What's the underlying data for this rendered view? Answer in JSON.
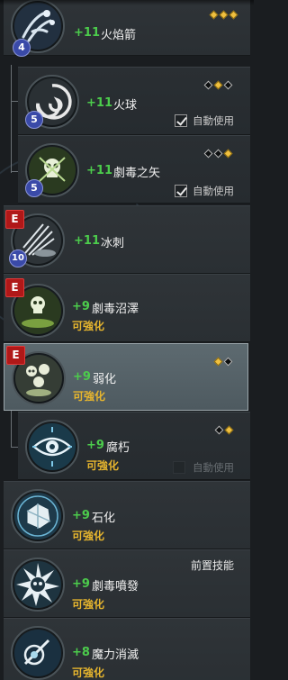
{
  "skills": [
    {
      "id": "fire-arrow",
      "bonus": "+11",
      "name": "火焰箭",
      "level": "4",
      "e_badge": false,
      "upgradable": null,
      "gems": [
        "gold",
        "gold",
        "gold"
      ],
      "auto_use": null,
      "prereq": null,
      "sub": false
    },
    {
      "id": "fireball",
      "bonus": "+11",
      "name": "火球",
      "level": "5",
      "e_badge": false,
      "upgradable": null,
      "gems": [
        "empty",
        "gold",
        "empty"
      ],
      "auto_use": {
        "label": "自動使用",
        "checked": true,
        "enabled": true
      },
      "prereq": null,
      "sub": true
    },
    {
      "id": "poison-arrow",
      "bonus": "+11",
      "name": "劇毒之矢",
      "level": "5",
      "e_badge": false,
      "upgradable": null,
      "gems": [
        "empty",
        "empty",
        "gold"
      ],
      "auto_use": {
        "label": "自動使用",
        "checked": true,
        "enabled": true
      },
      "prereq": null,
      "sub": true
    },
    {
      "id": "ice-spike",
      "bonus": "+11",
      "name": "冰刺",
      "level": "10",
      "e_badge": true,
      "e_label": "E",
      "upgradable": null,
      "gems": [],
      "auto_use": null,
      "prereq": null,
      "sub": false
    },
    {
      "id": "poison-swamp",
      "bonus": "+9",
      "name": "劇毒沼澤",
      "level": null,
      "e_badge": true,
      "e_label": "E",
      "upgradable": "可強化",
      "gems": [],
      "auto_use": null,
      "prereq": null,
      "sub": false
    },
    {
      "id": "weaken",
      "bonus": "+9",
      "name": "弱化",
      "level": null,
      "e_badge": true,
      "e_label": "E",
      "upgradable": "可強化",
      "gems": [
        "gold",
        "empty"
      ],
      "auto_use": null,
      "prereq": null,
      "sub": false,
      "selected": true
    },
    {
      "id": "decay",
      "bonus": "+9",
      "name": "腐朽",
      "level": null,
      "e_badge": false,
      "upgradable": "可強化",
      "gems": [
        "empty",
        "gold"
      ],
      "auto_use": {
        "label": "自動使用",
        "checked": false,
        "enabled": false
      },
      "prereq": null,
      "sub": true
    },
    {
      "id": "petrify",
      "bonus": "+9",
      "name": "石化",
      "level": null,
      "e_badge": false,
      "upgradable": "可強化",
      "gems": [],
      "auto_use": null,
      "prereq": null,
      "sub": false
    },
    {
      "id": "poison-burst",
      "bonus": "+9",
      "name": "劇毒噴發",
      "level": null,
      "e_badge": false,
      "upgradable": "可強化",
      "gems": [],
      "auto_use": null,
      "prereq": "前置技能",
      "sub": false
    },
    {
      "id": "mana-dispel",
      "bonus": "+8",
      "name": "魔力消滅",
      "level": null,
      "e_badge": false,
      "upgradable": "可強化",
      "gems": [],
      "auto_use": null,
      "prereq": null,
      "sub": false
    }
  ],
  "icons": [
    "fire-arrow-icon",
    "fireball-icon",
    "poison-arrow-icon",
    "ice-spike-icon",
    "poison-swamp-icon",
    "weaken-icon",
    "decay-icon",
    "petrify-icon",
    "poison-burst-icon",
    "mana-dispel-icon"
  ],
  "colors": {
    "bonus": "#4ccc4c",
    "upgradable": "#e6b52e",
    "e_badge": "#b01818",
    "level_badge": "#3a4aa8"
  }
}
